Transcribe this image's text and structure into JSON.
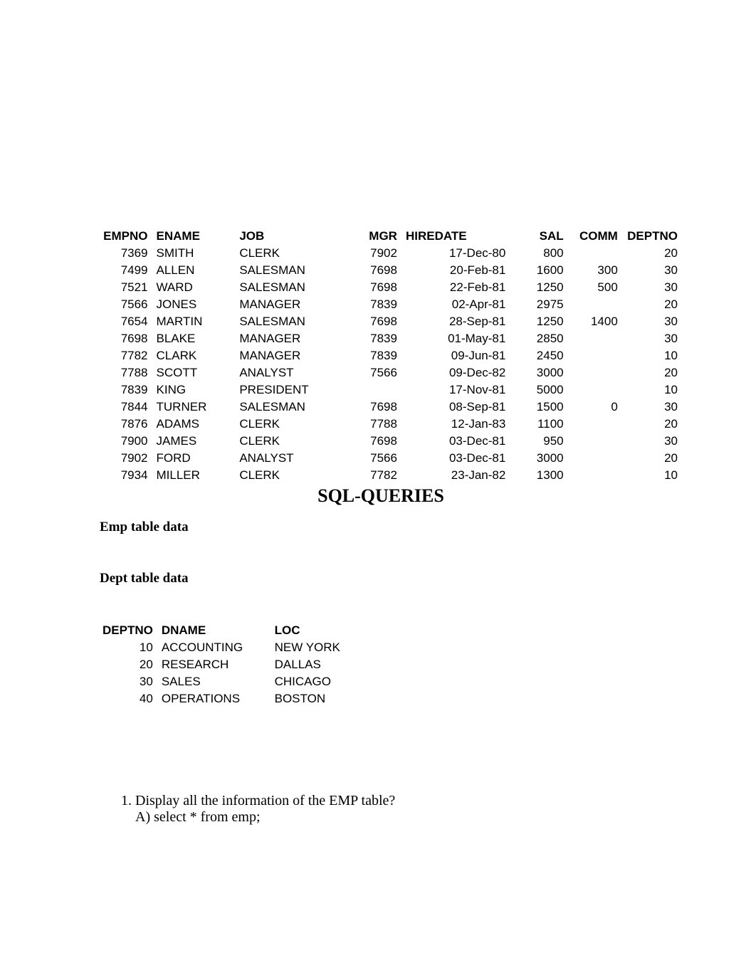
{
  "emp": {
    "headers": [
      "EMPNO",
      "ENAME",
      "JOB",
      "MGR",
      "HIREDATE",
      "SAL",
      "COMM",
      "DEPTNO"
    ],
    "rows": [
      {
        "empno": "7369",
        "ename": "SMITH",
        "job": "CLERK",
        "mgr": "7902",
        "hiredate": "17-Dec-80",
        "sal": "800",
        "comm": "",
        "deptno": "20"
      },
      {
        "empno": "7499",
        "ename": "ALLEN",
        "job": "SALESMAN",
        "mgr": "7698",
        "hiredate": "20-Feb-81",
        "sal": "1600",
        "comm": "300",
        "deptno": "30"
      },
      {
        "empno": "7521",
        "ename": "WARD",
        "job": "SALESMAN",
        "mgr": "7698",
        "hiredate": "22-Feb-81",
        "sal": "1250",
        "comm": "500",
        "deptno": "30"
      },
      {
        "empno": "7566",
        "ename": "JONES",
        "job": "MANAGER",
        "mgr": "7839",
        "hiredate": "02-Apr-81",
        "sal": "2975",
        "comm": "",
        "deptno": "20"
      },
      {
        "empno": "7654",
        "ename": "MARTIN",
        "job": "SALESMAN",
        "mgr": "7698",
        "hiredate": "28-Sep-81",
        "sal": "1250",
        "comm": "1400",
        "deptno": "30"
      },
      {
        "empno": "7698",
        "ename": "BLAKE",
        "job": "MANAGER",
        "mgr": "7839",
        "hiredate": "01-May-81",
        "sal": "2850",
        "comm": "",
        "deptno": "30"
      },
      {
        "empno": "7782",
        "ename": "CLARK",
        "job": "MANAGER",
        "mgr": "7839",
        "hiredate": "09-Jun-81",
        "sal": "2450",
        "comm": "",
        "deptno": "10"
      },
      {
        "empno": "7788",
        "ename": "SCOTT",
        "job": "ANALYST",
        "mgr": "7566",
        "hiredate": "09-Dec-82",
        "sal": "3000",
        "comm": "",
        "deptno": "20"
      },
      {
        "empno": "7839",
        "ename": "KING",
        "job": "PRESIDENT",
        "mgr": "",
        "hiredate": "17-Nov-81",
        "sal": "5000",
        "comm": "",
        "deptno": "10"
      },
      {
        "empno": "7844",
        "ename": "TURNER",
        "job": "SALESMAN",
        "mgr": "7698",
        "hiredate": "08-Sep-81",
        "sal": "1500",
        "comm": "0",
        "deptno": "30"
      },
      {
        "empno": "7876",
        "ename": "ADAMS",
        "job": "CLERK",
        "mgr": "7788",
        "hiredate": "12-Jan-83",
        "sal": "1100",
        "comm": "",
        "deptno": "20"
      },
      {
        "empno": "7900",
        "ename": "JAMES",
        "job": "CLERK",
        "mgr": "7698",
        "hiredate": "03-Dec-81",
        "sal": "950",
        "comm": "",
        "deptno": "30"
      },
      {
        "empno": "7902",
        "ename": "FORD",
        "job": "ANALYST",
        "mgr": "7566",
        "hiredate": "03-Dec-81",
        "sal": "3000",
        "comm": "",
        "deptno": "20"
      },
      {
        "empno": "7934",
        "ename": "MILLER",
        "job": "CLERK",
        "mgr": "7782",
        "hiredate": "23-Jan-82",
        "sal": "1300",
        "comm": "",
        "deptno": "10"
      }
    ]
  },
  "title": "SQL-QUERIES",
  "subhead_emp": "Emp table data",
  "subhead_dept": "Dept table data",
  "dept": {
    "headers": [
      "DEPTNO",
      "DNAME",
      "LOC"
    ],
    "rows": [
      {
        "deptno": "10",
        "dname": "ACCOUNTING",
        "loc": "NEW YORK"
      },
      {
        "deptno": "20",
        "dname": "RESEARCH",
        "loc": "DALLAS"
      },
      {
        "deptno": "30",
        "dname": "SALES",
        "loc": "CHICAGO"
      },
      {
        "deptno": "40",
        "dname": "OPERATIONS",
        "loc": "BOSTON"
      }
    ]
  },
  "questions": [
    {
      "q": "Display all the information of the EMP table?",
      "a": "A) select * from emp;"
    }
  ]
}
